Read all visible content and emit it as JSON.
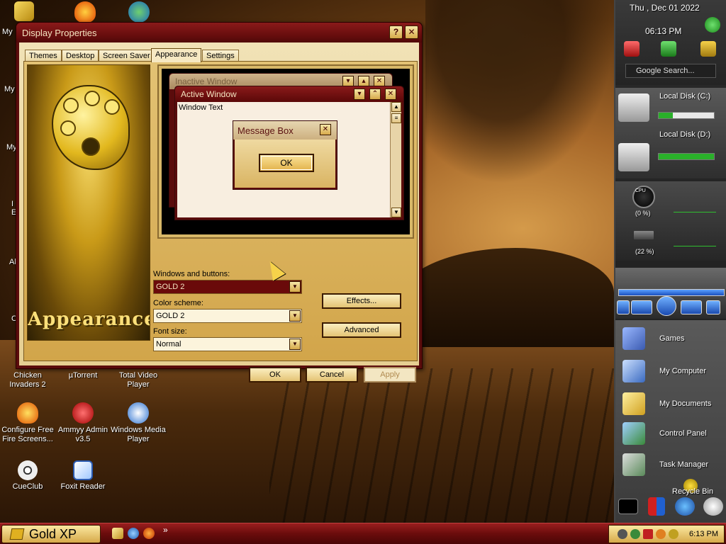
{
  "window": {
    "title": "Display Properties",
    "help_icon": "?",
    "close_icon": "✕",
    "tabs": [
      {
        "label": "Themes"
      },
      {
        "label": "Desktop"
      },
      {
        "label": "Screen Saver"
      },
      {
        "label": "Appearance"
      },
      {
        "label": "Settings"
      }
    ],
    "active_tab": "Appearance",
    "side_banner_text": "Appearance",
    "preview": {
      "inactive_title": "Inactive Window",
      "active_title": "Active Window",
      "window_text": "Window Text",
      "message_box_title": "Message Box",
      "message_box_ok": "OK"
    },
    "windows_buttons_label": "Windows and buttons:",
    "windows_buttons_value": "GOLD 2",
    "color_scheme_label": "Color scheme:",
    "color_scheme_value": "GOLD 2",
    "font_size_label": "Font size:",
    "font_size_value": "Normal",
    "effects_button": "Effects...",
    "advanced_button": "Advanced",
    "ok_button": "OK",
    "cancel_button": "Cancel",
    "apply_button": "Apply"
  },
  "desktop_icons": [
    {
      "label": "Chicken Invaders 2"
    },
    {
      "label": "µTorrent"
    },
    {
      "label": "Total Video Player"
    },
    {
      "label": "Configure Free Fire Screens..."
    },
    {
      "label": "Ammyy Admin v3.5"
    },
    {
      "label": "Windows Media Player"
    },
    {
      "label": "CueClub"
    },
    {
      "label": "Foxit Reader"
    }
  ],
  "edge_labels": [
    "My",
    "My",
    "My",
    "I",
    "E",
    "Al",
    "C"
  ],
  "sidebar": {
    "date": "Thu , Dec 01 2022",
    "time": "06:13 PM",
    "search_placeholder": "Google Search...",
    "disks": [
      {
        "label": "Local Disk (C:)",
        "usage": 0.25
      },
      {
        "label": "Local Disk (D:)",
        "usage": 1.0
      }
    ],
    "cpu_label": "CPU",
    "cpu_percent": "(0 %)",
    "ram_percent": "(22 %)",
    "launch_items": [
      {
        "label": "Games"
      },
      {
        "label": "My Computer"
      },
      {
        "label": "My Documents"
      },
      {
        "label": "Control Panel"
      },
      {
        "label": "Task Manager"
      },
      {
        "label": "Recycle Bin"
      }
    ]
  },
  "taskbar": {
    "start_label": "Gold XP",
    "clock": "6:13 PM",
    "overflow": "»"
  },
  "colors": {
    "accent": "#6a0a0a",
    "gold": "#d6a94a",
    "title_text": "#f4e4c0"
  }
}
